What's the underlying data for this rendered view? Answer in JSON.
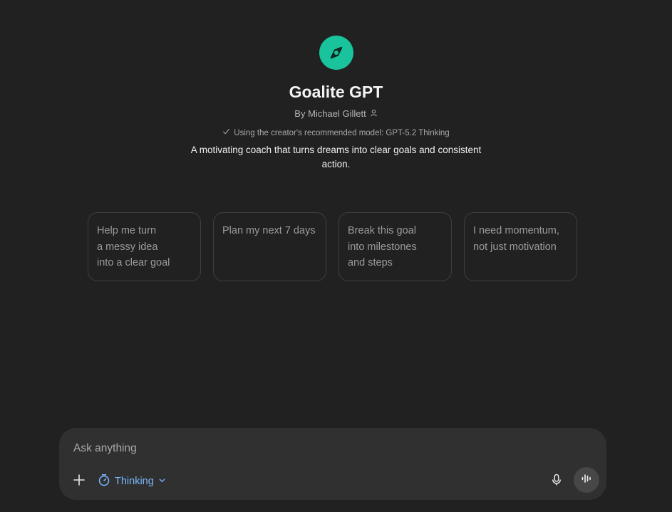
{
  "gpt": {
    "name": "Goalite GPT",
    "byline": "By Michael Gillett",
    "model_note": "Using the creator's recommended model: GPT-5.2 Thinking",
    "description": "A motivating coach that turns dreams into clear goals and consistent action.",
    "logo_icon": "compass-icon",
    "logo_color": "#19c39c"
  },
  "starters": [
    {
      "lines": [
        "Help me turn",
        "a messy idea",
        "into a clear goal"
      ]
    },
    {
      "lines": [
        "Plan my next 7 days"
      ]
    },
    {
      "lines": [
        "Break this goal",
        "into milestones",
        "and steps"
      ]
    },
    {
      "lines": [
        "I need momentum,",
        "not just motivation"
      ]
    }
  ],
  "composer": {
    "placeholder": "Ask anything",
    "mode_label": "Thinking",
    "mode_color": "#7ab7ff",
    "icons": [
      "plus-icon",
      "timer-icon",
      "chevron-down-icon",
      "microphone-icon",
      "voice-wave-icon"
    ]
  },
  "colors": {
    "background": "#212121",
    "composer": "#303030",
    "accent": "#19c39c"
  }
}
